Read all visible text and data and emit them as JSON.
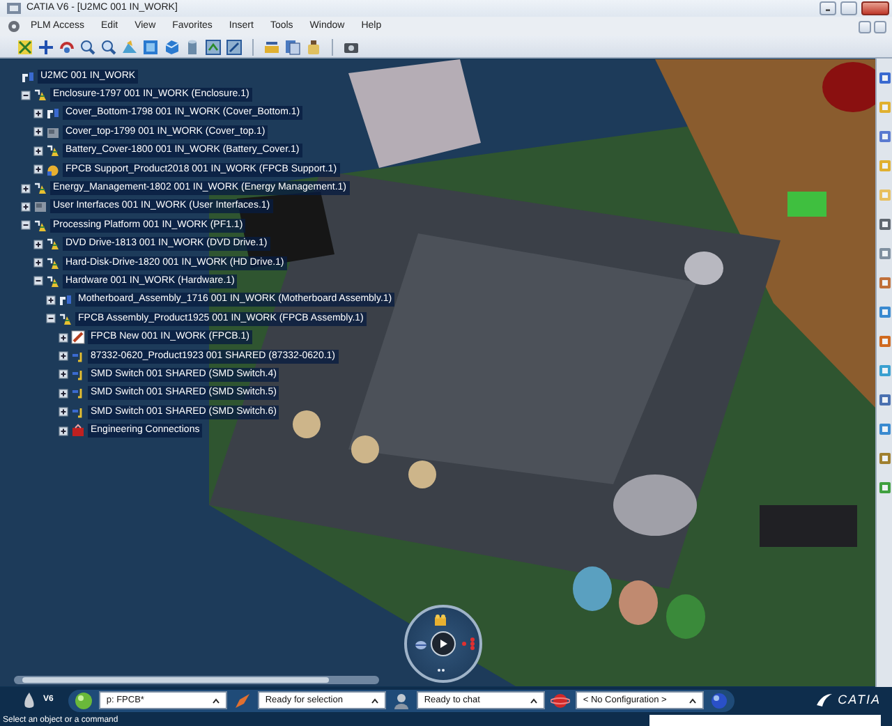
{
  "window": {
    "title": "CATIA V6 - [U2MC 001 IN_WORK]"
  },
  "menu": [
    "PLM Access",
    "Edit",
    "View",
    "Favorites",
    "Insert",
    "Tools",
    "Window",
    "Help"
  ],
  "tree": {
    "label": "U2MC 001 IN_WORK",
    "kind": "part",
    "children": [
      {
        "label": "Enclosure-1797 001 IN_WORK (Enclosure.1)",
        "kind": "product",
        "expanded": true,
        "children": [
          {
            "label": "Cover_Bottom-1798 001 IN_WORK (Cover_Bottom.1)",
            "kind": "part",
            "expanded": false
          },
          {
            "label": "Cover_top-1799 001 IN_WORK (Cover_top.1)",
            "kind": "block",
            "expanded": false
          },
          {
            "label": "Battery_Cover-1800 001 IN_WORK (Battery_Cover.1)",
            "kind": "product",
            "expanded": false
          },
          {
            "label": "FPCB Support_Product2018 001 IN_WORK (FPCB Support.1)",
            "kind": "support",
            "expanded": false
          }
        ]
      },
      {
        "label": "Energy_Management-1802 001 IN_WORK (Energy Management.1)",
        "kind": "product",
        "expanded": false
      },
      {
        "label": "User Interfaces 001 IN_WORK (User Interfaces.1)",
        "kind": "block",
        "expanded": false
      },
      {
        "label": "Processing Platform 001 IN_WORK (PF1.1)",
        "kind": "product",
        "expanded": true,
        "children": [
          {
            "label": "DVD Drive-1813 001 IN_WORK (DVD Drive.1)",
            "kind": "product",
            "expanded": false
          },
          {
            "label": "Hard-Disk-Drive-1820 001 IN_WORK (HD Drive.1)",
            "kind": "product",
            "expanded": false
          },
          {
            "label": "Hardware 001 IN_WORK (Hardware.1)",
            "kind": "product",
            "expanded": true,
            "children": [
              {
                "label": "Motherboard_Assembly_1716 001 IN_WORK (Motherboard Assembly.1)",
                "kind": "part",
                "expanded": false
              },
              {
                "label": "FPCB Assembly_Product1925 001 IN_WORK (FPCB Assembly.1)",
                "kind": "product",
                "expanded": true,
                "children": [
                  {
                    "label": "FPCB New 001 IN_WORK (FPCB.1)",
                    "kind": "board",
                    "expanded": false
                  },
                  {
                    "label": "87332-0620_Product1923 001 SHARED (87332-0620.1)",
                    "kind": "shared",
                    "expanded": false
                  },
                  {
                    "label": "SMD Switch 001 SHARED (SMD Switch.4)",
                    "kind": "shared",
                    "expanded": false
                  },
                  {
                    "label": "SMD Switch 001 SHARED (SMD Switch.5)",
                    "kind": "shared",
                    "expanded": false
                  },
                  {
                    "label": "SMD Switch 001 SHARED (SMD Switch.6)",
                    "kind": "shared",
                    "expanded": false
                  },
                  {
                    "label": "Engineering Connections",
                    "kind": "connections",
                    "expanded": false
                  }
                ]
              }
            ]
          }
        ]
      }
    ]
  },
  "status_bar": {
    "brand": "V6",
    "fields": [
      "p: FPCB*",
      "Ready for selection",
      "Ready to chat",
      "< No Configuration >"
    ],
    "logo": "CATIA"
  },
  "message": "Select an object or a command"
}
